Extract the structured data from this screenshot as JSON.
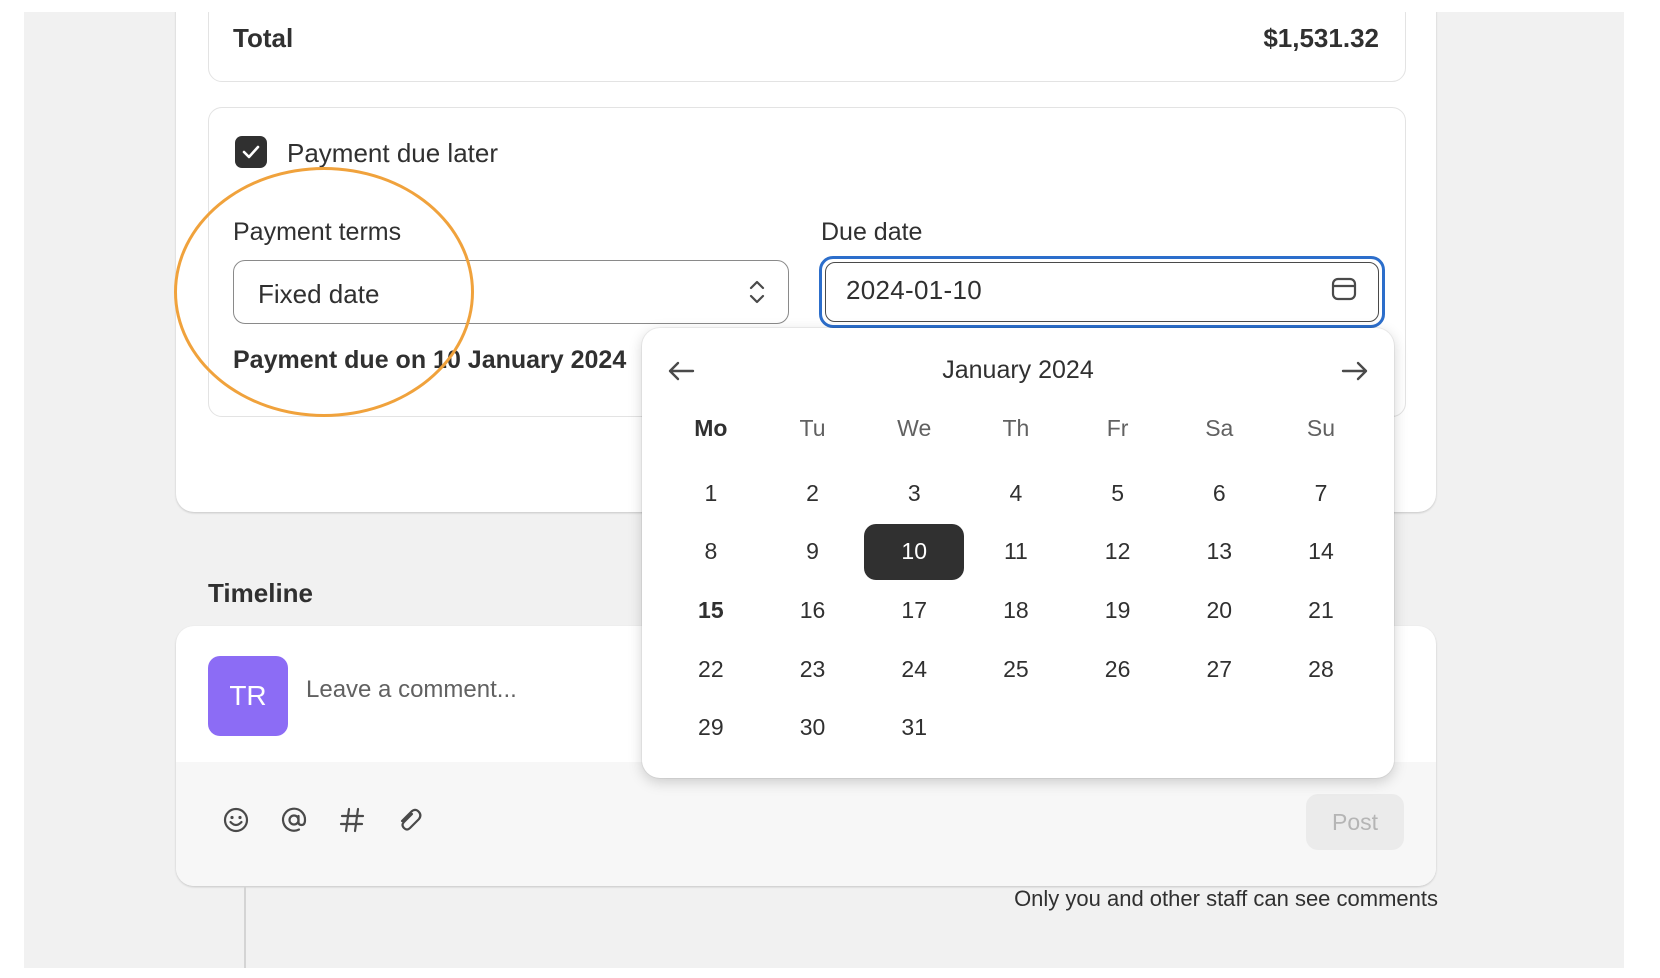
{
  "order": {
    "total_label": "Total",
    "total_value": "$1,531.32"
  },
  "payment": {
    "checkbox_label": "Payment due later",
    "checkbox_checked": true,
    "terms_label": "Payment terms",
    "terms_value": "Fixed date",
    "due_label": "Due date",
    "due_value": "2024-01-10",
    "summary": "Payment due on 10 January 2024"
  },
  "calendar": {
    "title": "January 2024",
    "weekdays": [
      "Mo",
      "Tu",
      "We",
      "Th",
      "Fr",
      "Sa",
      "Su"
    ],
    "days": [
      "1",
      "2",
      "3",
      "4",
      "5",
      "6",
      "7",
      "8",
      "9",
      "10",
      "11",
      "12",
      "13",
      "14",
      "15",
      "16",
      "17",
      "18",
      "19",
      "20",
      "21",
      "22",
      "23",
      "24",
      "25",
      "26",
      "27",
      "28",
      "29",
      "30",
      "31"
    ],
    "selected_day": "10",
    "today": "15",
    "prev_icon": "arrow-left-icon",
    "next_icon": "arrow-right-icon"
  },
  "timeline": {
    "heading": "Timeline",
    "avatar_initials": "TR",
    "avatar_color": "#8c6cf5",
    "comment_placeholder": "Leave a comment...",
    "tools": [
      "emoji-icon",
      "mention-icon",
      "hashtag-icon",
      "attachment-icon"
    ],
    "post_label": "Post",
    "note": "Only you and other staff can see comments"
  },
  "colors": {
    "focus": "#2c6ecb",
    "highlight": "#f0a23c",
    "selected_bg": "#303030"
  }
}
